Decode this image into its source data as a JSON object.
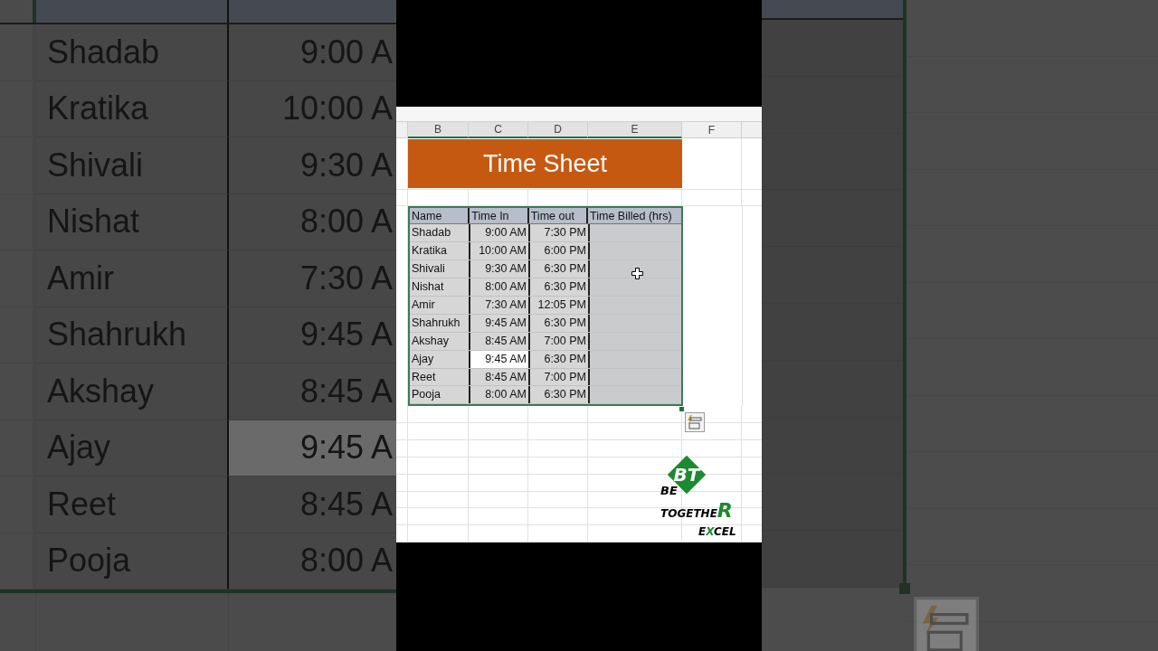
{
  "backdrop": {
    "rows": [
      {
        "name": "Shadab",
        "time_in": "9:00 A",
        "selected": false
      },
      {
        "name": "Kratika",
        "time_in": "10:00 A",
        "selected": false
      },
      {
        "name": "Shivali",
        "time_in": "9:30 A",
        "selected": false
      },
      {
        "name": "Nishat",
        "time_in": "8:00 A",
        "selected": false
      },
      {
        "name": "Amir",
        "time_in": "7:30 A",
        "selected": false
      },
      {
        "name": "Shahrukh",
        "time_in": "9:45 A",
        "selected": false
      },
      {
        "name": "Akshay",
        "time_in": "8:45 A",
        "selected": false
      },
      {
        "name": "Ajay",
        "time_in": "9:45 A",
        "selected": true
      },
      {
        "name": "Reet",
        "time_in": "8:45 A",
        "selected": false
      },
      {
        "name": "Pooja",
        "time_in": "8:00 A",
        "selected": false
      }
    ]
  },
  "sheet": {
    "column_headers": [
      "B",
      "C",
      "D",
      "E",
      "F"
    ],
    "title": "Time Sheet",
    "table": {
      "columns": [
        "Name",
        "Time In",
        "Time out",
        "Time Billed (hrs)"
      ],
      "rows": [
        {
          "name": "Shadab",
          "time_in": "9:00 AM",
          "time_out": "7:30 PM",
          "selected": false
        },
        {
          "name": "Kratika",
          "time_in": "10:00 AM",
          "time_out": "6:00 PM",
          "selected": false
        },
        {
          "name": "Shivali",
          "time_in": "9:30 AM",
          "time_out": "6:30 PM",
          "selected": false
        },
        {
          "name": "Nishat",
          "time_in": "8:00 AM",
          "time_out": "6:30 PM",
          "selected": false
        },
        {
          "name": "Amir",
          "time_in": "7:30 AM",
          "time_out": "12:05 PM",
          "selected": false
        },
        {
          "name": "Shahrukh",
          "time_in": "9:45 AM",
          "time_out": "6:30 PM",
          "selected": false
        },
        {
          "name": "Akshay",
          "time_in": "8:45 AM",
          "time_out": "7:00 PM",
          "selected": false
        },
        {
          "name": "Ajay",
          "time_in": "9:45 AM",
          "time_out": "6:30 PM",
          "selected": true
        },
        {
          "name": "Reet",
          "time_in": "8:45 AM",
          "time_out": "7:00 PM",
          "selected": false
        },
        {
          "name": "Pooja",
          "time_in": "8:00 AM",
          "time_out": "6:30 PM",
          "selected": false
        }
      ]
    }
  },
  "logo": {
    "mark": "BT",
    "line1": "BE",
    "line2": "TOGETHE",
    "line2_end": "R",
    "line3_parts": [
      {
        "text": "E",
        "accent": false
      },
      {
        "text": "X",
        "accent": true
      },
      {
        "text": "CEL",
        "accent": false
      }
    ]
  }
}
